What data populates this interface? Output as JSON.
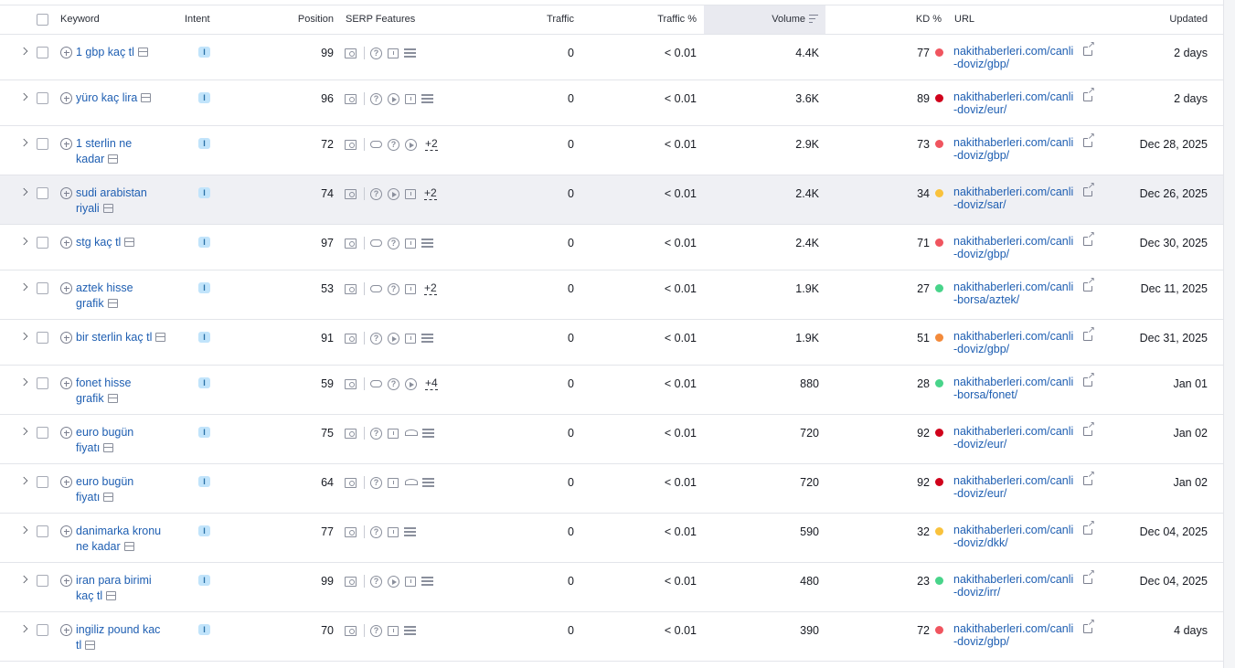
{
  "columns": {
    "keyword": "Keyword",
    "intent": "Intent",
    "position": "Position",
    "serp_features": "SERP Features",
    "traffic": "Traffic",
    "traffic_pct": "Traffic %",
    "volume": "Volume",
    "kd": "KD %",
    "url": "URL",
    "updated": "Updated"
  },
  "sorted_column": "volume",
  "kd_colors": {
    "very_hard": "#d0021b",
    "hard": "#f0555f",
    "difficult": "#f38a3a",
    "possible": "#f9c23c",
    "easy": "#48d48a"
  },
  "rows": [
    {
      "keyword_lines": [
        "1 gbp kaç tl"
      ],
      "intent": "I",
      "position": "99",
      "serp": [
        "image",
        "sep",
        "question",
        "message",
        "list"
      ],
      "serp_more": "",
      "traffic": "0",
      "traffic_pct": "< 0.01",
      "volume": "4.4K",
      "kd": "77",
      "kd_level": "hard",
      "url_lines": [
        "nakithaberleri.com/canli",
        "-doviz/gbp/"
      ],
      "updated": "2 days"
    },
    {
      "keyword_lines": [
        "yüro kaç lira"
      ],
      "intent": "I",
      "position": "96",
      "serp": [
        "image",
        "sep",
        "question",
        "play",
        "message",
        "list"
      ],
      "serp_more": "",
      "traffic": "0",
      "traffic_pct": "< 0.01",
      "volume": "3.6K",
      "kd": "89",
      "kd_level": "very_hard",
      "url_lines": [
        "nakithaberleri.com/canli",
        "-doviz/eur/"
      ],
      "updated": "2 days"
    },
    {
      "keyword_lines": [
        "1 sterlin ne",
        "kadar"
      ],
      "intent": "I",
      "position": "72",
      "serp": [
        "image",
        "sep",
        "link",
        "question",
        "play"
      ],
      "serp_more": "+2",
      "traffic": "0",
      "traffic_pct": "< 0.01",
      "volume": "2.9K",
      "kd": "73",
      "kd_level": "hard",
      "url_lines": [
        "nakithaberleri.com/canli",
        "-doviz/gbp/"
      ],
      "updated": "Dec 28, 2025"
    },
    {
      "keyword_lines": [
        "sudi arabistan",
        "riyali"
      ],
      "intent": "I",
      "position": "74",
      "serp": [
        "image",
        "sep",
        "question",
        "play",
        "message"
      ],
      "serp_more": "+2",
      "traffic": "0",
      "traffic_pct": "< 0.01",
      "volume": "2.4K",
      "kd": "34",
      "kd_level": "possible",
      "url_lines": [
        "nakithaberleri.com/canli",
        "-doviz/sar/"
      ],
      "updated": "Dec 26, 2025",
      "highlight": true
    },
    {
      "keyword_lines": [
        "stg kaç tl"
      ],
      "intent": "I",
      "position": "97",
      "serp": [
        "image",
        "sep",
        "link",
        "question",
        "message",
        "list"
      ],
      "serp_more": "",
      "traffic": "0",
      "traffic_pct": "< 0.01",
      "volume": "2.4K",
      "kd": "71",
      "kd_level": "hard",
      "url_lines": [
        "nakithaberleri.com/canli",
        "-doviz/gbp/"
      ],
      "updated": "Dec 30, 2025"
    },
    {
      "keyword_lines": [
        "aztek hisse",
        "grafik"
      ],
      "intent": "I",
      "position": "53",
      "serp": [
        "image",
        "sep",
        "link",
        "question",
        "message"
      ],
      "serp_more": "+2",
      "traffic": "0",
      "traffic_pct": "< 0.01",
      "volume": "1.9K",
      "kd": "27",
      "kd_level": "easy",
      "url_lines": [
        "nakithaberleri.com/canli",
        "-borsa/aztek/"
      ],
      "updated": "Dec 11, 2025"
    },
    {
      "keyword_lines": [
        "bir sterlin kaç tl"
      ],
      "intent": "I",
      "position": "91",
      "serp": [
        "image",
        "sep",
        "question",
        "play",
        "message",
        "list"
      ],
      "serp_more": "",
      "traffic": "0",
      "traffic_pct": "< 0.01",
      "volume": "1.9K",
      "kd": "51",
      "kd_level": "difficult",
      "url_lines": [
        "nakithaberleri.com/canli",
        "-doviz/gbp/"
      ],
      "updated": "Dec 31, 2025"
    },
    {
      "keyword_lines": [
        "fonet hisse",
        "grafik"
      ],
      "intent": "I",
      "position": "59",
      "serp": [
        "image",
        "sep",
        "link",
        "question",
        "play"
      ],
      "serp_more": "+4",
      "traffic": "0",
      "traffic_pct": "< 0.01",
      "volume": "880",
      "kd": "28",
      "kd_level": "easy",
      "url_lines": [
        "nakithaberleri.com/canli",
        "-borsa/fonet/"
      ],
      "updated": "Jan 01"
    },
    {
      "keyword_lines": [
        "euro bugün",
        "fiyatı"
      ],
      "intent": "I",
      "position": "75",
      "serp": [
        "image",
        "sep",
        "question",
        "message",
        "cap",
        "list"
      ],
      "serp_more": "",
      "traffic": "0",
      "traffic_pct": "< 0.01",
      "volume": "720",
      "kd": "92",
      "kd_level": "very_hard",
      "url_lines": [
        "nakithaberleri.com/canli",
        "-doviz/eur/"
      ],
      "updated": "Jan 02"
    },
    {
      "keyword_lines": [
        "euro bugün",
        "fiyatı"
      ],
      "intent": "I",
      "position": "64",
      "serp": [
        "image",
        "sep",
        "question",
        "message",
        "cap",
        "list"
      ],
      "serp_more": "",
      "traffic": "0",
      "traffic_pct": "< 0.01",
      "volume": "720",
      "kd": "92",
      "kd_level": "very_hard",
      "url_lines": [
        "nakithaberleri.com/canli",
        "-doviz/eur/"
      ],
      "updated": "Jan 02"
    },
    {
      "keyword_lines": [
        "danimarka kronu",
        "ne kadar"
      ],
      "intent": "I",
      "position": "77",
      "serp": [
        "image",
        "sep",
        "question",
        "message",
        "list"
      ],
      "serp_more": "",
      "traffic": "0",
      "traffic_pct": "< 0.01",
      "volume": "590",
      "kd": "32",
      "kd_level": "possible",
      "url_lines": [
        "nakithaberleri.com/canli",
        "-doviz/dkk/"
      ],
      "updated": "Dec 04, 2025"
    },
    {
      "keyword_lines": [
        "iran para birimi",
        "kaç tl"
      ],
      "intent": "I",
      "position": "99",
      "serp": [
        "image",
        "sep",
        "question",
        "play",
        "message",
        "list"
      ],
      "serp_more": "",
      "traffic": "0",
      "traffic_pct": "< 0.01",
      "volume": "480",
      "kd": "23",
      "kd_level": "easy",
      "url_lines": [
        "nakithaberleri.com/canli",
        "-doviz/irr/"
      ],
      "updated": "Dec 04, 2025"
    },
    {
      "keyword_lines": [
        "ingiliz pound kac",
        "tl"
      ],
      "intent": "I",
      "position": "70",
      "serp": [
        "image",
        "sep",
        "question",
        "message",
        "list"
      ],
      "serp_more": "",
      "traffic": "0",
      "traffic_pct": "< 0.01",
      "volume": "390",
      "kd": "72",
      "kd_level": "hard",
      "url_lines": [
        "nakithaberleri.com/canli",
        "-doviz/gbp/"
      ],
      "updated": "4 days"
    }
  ]
}
